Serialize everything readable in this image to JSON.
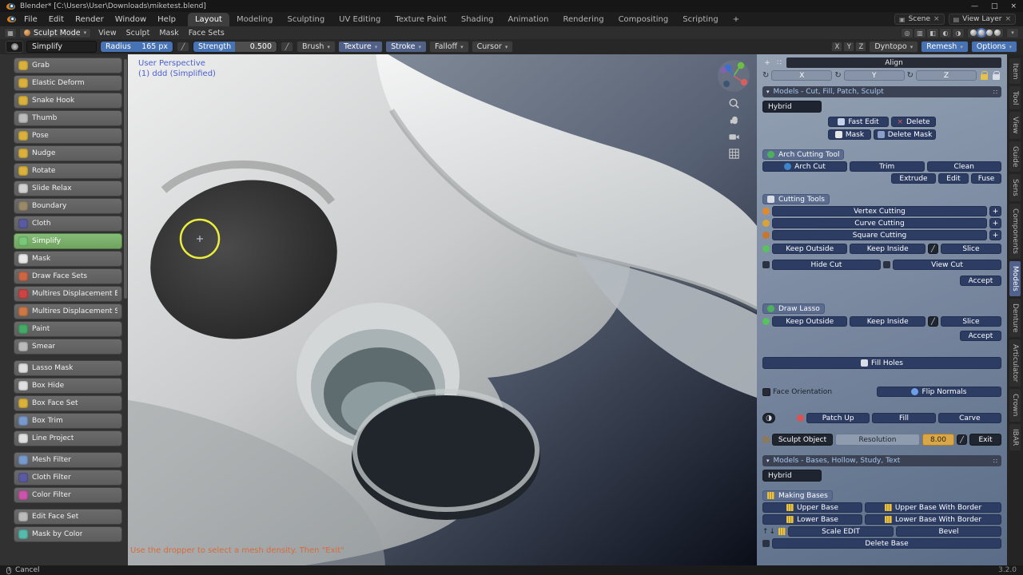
{
  "colors": {
    "accent_blue": "#4772b3",
    "active_green": "#6fa35f",
    "amber": "#d9a648",
    "hint_orange": "#d96a3a",
    "overlay_blue": "#4a5fd0"
  },
  "icons": {
    "chevron_down": "▾",
    "close": "×",
    "plus": "+",
    "loop": "↻",
    "up": "↑",
    "down": "↓",
    "menu_dots": "∷",
    "collapse": "▾",
    "pen": "╱"
  },
  "titlebar": {
    "title": "Blender* [C:\\Users\\User\\Downloads\\miketest.blend]",
    "controls": [
      "—",
      "□",
      "×"
    ]
  },
  "menubar": {
    "menus": [
      "File",
      "Edit",
      "Render",
      "Window",
      "Help"
    ],
    "scene_selector": "Scene",
    "view_layer_selector": "View Layer"
  },
  "workspace_tabs": [
    {
      "label": "Layout",
      "active": true
    },
    {
      "label": "Modeling"
    },
    {
      "label": "Sculpting"
    },
    {
      "label": "UV Editing"
    },
    {
      "label": "Texture Paint"
    },
    {
      "label": "Shading"
    },
    {
      "label": "Animation"
    },
    {
      "label": "Rendering"
    },
    {
      "label": "Compositing"
    },
    {
      "label": "Scripting"
    },
    {
      "label": "+"
    }
  ],
  "mode_bar": {
    "mode": "Sculpt Mode",
    "menus": [
      "View",
      "Sculpt",
      "Mask",
      "Face Sets"
    ],
    "right_icons": [
      "◎",
      "▥",
      "◧",
      "◐",
      "◑"
    ]
  },
  "tool_settings": {
    "brush_name": "Simplify",
    "radius_label": "Radius",
    "radius_value": "165 px",
    "strength_label": "Strength",
    "strength_value": "0.500",
    "dropdowns": [
      {
        "label": "Brush"
      },
      {
        "label": "Texture",
        "active": true
      },
      {
        "label": "Stroke",
        "active": true
      },
      {
        "label": "Falloff"
      },
      {
        "label": "Cursor"
      }
    ],
    "mirror_axes": [
      "X",
      "Y",
      "Z"
    ],
    "dyntopo": "Dyntopo",
    "remesh": "Remesh",
    "options": "Options"
  },
  "toolbar": {
    "items": [
      {
        "label": "Grab",
        "color": "#d9b13b"
      },
      {
        "label": "Elastic Deform",
        "color": "#d9b13b"
      },
      {
        "label": "Snake Hook",
        "color": "#d9b13b"
      },
      {
        "label": "Thumb",
        "color": "#bcbcbc"
      },
      {
        "label": "Pose",
        "color": "#d9b13b"
      },
      {
        "label": "Nudge",
        "color": "#d9b13b"
      },
      {
        "label": "Rotate",
        "color": "#d9b13b"
      },
      {
        "label": "Slide Relax",
        "color": "#d2d2d2"
      },
      {
        "label": "Boundary",
        "color": "#9a8a6a"
      },
      {
        "label": "Cloth",
        "color": "#5a5aa0"
      },
      {
        "label": "Simplify",
        "color": "#79c879",
        "active": true
      },
      {
        "label": "Mask",
        "color": "#e8e8e8"
      },
      {
        "label": "Draw Face Sets",
        "color": "#cc6644"
      },
      {
        "label": "Multires Displacement Eraser",
        "color": "#cc4444"
      },
      {
        "label": "Multires Displacement Smear",
        "color": "#cc7744"
      },
      {
        "label": "Paint",
        "color": "#44aa66"
      },
      {
        "label": "Smear",
        "color": "#bbbbbb"
      },
      {
        "label": "Lasso Mask",
        "color": "#e0e0e0",
        "gap": true
      },
      {
        "label": "Box Hide",
        "color": "#e0e0e0"
      },
      {
        "label": "Box Face Set",
        "color": "#d9b13b"
      },
      {
        "label": "Box Trim",
        "color": "#7799cc"
      },
      {
        "label": "Line Project",
        "color": "#e0e0e0"
      },
      {
        "label": "Mesh Filter",
        "color": "#7799cc",
        "gap": true
      },
      {
        "label": "Cloth Filter",
        "color": "#5a5aa0"
      },
      {
        "label": "Color Filter",
        "color": "#cc55aa"
      },
      {
        "label": "Edit Face Set",
        "color": "#bbbbbb",
        "gap": true
      },
      {
        "label": "Mask by Color",
        "color": "#55bbaa"
      }
    ]
  },
  "viewport": {
    "overlay_line1": "User Perspective",
    "overlay_line2": "(1) ddd (Simplified)",
    "hint_text": "Use the dropper to select a mesh density. Then \"Exit\""
  },
  "panel": {
    "align_title": "Align",
    "axes": [
      "X",
      "Y",
      "Z"
    ],
    "section_models_cut": "Models - Cut, Fill, Patch, Sculpt",
    "hybrid": "Hybrid",
    "fast_edit": "Fast Edit",
    "delete": "Delete",
    "mask": "Mask",
    "delete_mask": "Delete Mask",
    "arch_title": "Arch Cutting Tool",
    "arch_cut": "Arch Cut",
    "trim": "Trim",
    "clean": "Clean",
    "extrude": "Extrude",
    "edit": "Edit",
    "fuse": "Fuse",
    "cutting_title": "Cutting Tools",
    "cutting_rows": [
      {
        "label": "Vertex Cutting",
        "color": "#e08a2e"
      },
      {
        "label": "Curve Cutting",
        "color": "#d8a43a"
      },
      {
        "label": "Square Cutting",
        "color": "#c8762e"
      }
    ],
    "keep_outside": "Keep Outside",
    "keep_inside": "Keep Inside",
    "slice": "Slice",
    "hide_cut": "Hide Cut",
    "view_cut": "View Cut",
    "accept": "Accept",
    "draw_lasso": "Draw Lasso",
    "fill_holes": "Fill Holes",
    "face_orientation": "Face Orientation",
    "flip_normals": "Flip Normals",
    "patch_up": "Patch Up",
    "fill": "Fill",
    "carve": "Carve",
    "sculpt_object": "Sculpt Object",
    "resolution_label": "Resolution",
    "resolution_value": "8.00",
    "exit": "Exit",
    "section_models_bases": "Models - Bases, Hollow, Study, Text",
    "hybrid2": "Hybrid",
    "making_bases": "Making Bases",
    "upper_base": "Upper Base",
    "upper_base_border": "Upper Base With Border",
    "lower_base": "Lower Base",
    "lower_base_border": "Lower Base With Border",
    "scale_edit": "Scale EDIT",
    "bevel": "Bevel",
    "delete_base": "Delete Base"
  },
  "side_tabs": [
    {
      "label": "Item"
    },
    {
      "label": "Tool"
    },
    {
      "label": "View"
    },
    {
      "label": "Guide"
    },
    {
      "label": "Sens"
    },
    {
      "label": "Components"
    },
    {
      "label": "Models",
      "active": true
    },
    {
      "label": "Denture"
    },
    {
      "label": "Articulator"
    },
    {
      "label": "Crown"
    },
    {
      "label": "IBAR"
    }
  ],
  "statusbar": {
    "cancel": "Cancel",
    "version": "3.2.0"
  }
}
